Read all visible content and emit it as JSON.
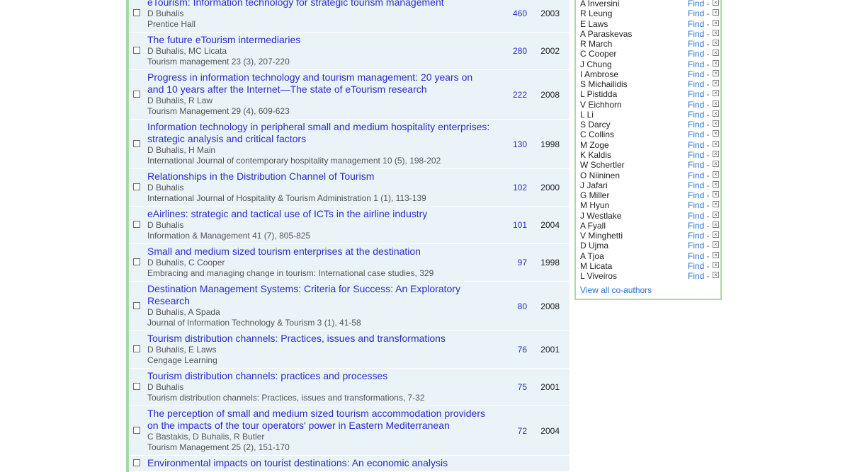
{
  "publications": [
    {
      "title": "eTourism: Information technology for strategic tourism management",
      "authors": "D Buhalis",
      "venue": "Prentice Hall",
      "cites": "460",
      "year": "2003"
    },
    {
      "title": "The future eTourism intermediaries",
      "authors": "D Buhalis, MC Licata",
      "venue": "Tourism management 23 (3), 207-220",
      "cites": "280",
      "year": "2002"
    },
    {
      "title": "Progress in information technology and tourism management: 20 years on and 10 years after the Internet—The state of eTourism research",
      "authors": "D Buhalis, R Law",
      "venue": "Tourism Management 29 (4), 609-623",
      "cites": "222",
      "year": "2008"
    },
    {
      "title": "Information technology in peripheral small and medium hospitality enterprises: strategic analysis and critical factors",
      "authors": "D Buhalis, H Main",
      "venue": "International Journal of contemporary hospitality management 10 (5), 198-202",
      "cites": "130",
      "year": "1998"
    },
    {
      "title": "Relationships in the Distribution Channel of Tourism",
      "authors": "D Buhalis",
      "venue": "International Journal of Hospitality & Tourism Administration 1 (1), 113-139",
      "cites": "102",
      "year": "2000"
    },
    {
      "title": "eAirlines: strategic and tactical use of ICTs in the airline industry",
      "authors": "D Buhalis",
      "venue": "Information & Management 41 (7), 805-825",
      "cites": "101",
      "year": "2004"
    },
    {
      "title": "Small and medium sized tourism enterprises at the destination",
      "authors": "D Buhalis, C Cooper",
      "venue": "Embracing and managing change in tourism: International case studies, 329",
      "cites": "97",
      "year": "1998"
    },
    {
      "title": "Destination Management Systems: Criteria for Success: An Exploratory Research",
      "authors": "D Buhalis, A Spada",
      "venue": "Journal of Information Technology & Tourism 3 (1), 41-58",
      "cites": "80",
      "year": "2008"
    },
    {
      "title": "Tourism distribution channels: Practices, issues and transformations",
      "authors": "D Buhalis, E Laws",
      "venue": "Cengage Learning",
      "cites": "76",
      "year": "2001"
    },
    {
      "title": "Tourism distribution channels: practices and processes",
      "authors": "D Buhalis",
      "venue": "Tourism distribution channels: Practices, issues and transformations, 7-32",
      "cites": "75",
      "year": "2001"
    },
    {
      "title": "The perception of small and medium sized tourism accommodation providers on the impacts of the tour operators' power in Eastern Mediterranean",
      "authors": "C Bastakis, D Buhalis, R Butler",
      "venue": "Tourism Management 25 (2), 151-170",
      "cites": "72",
      "year": "2004"
    },
    {
      "title": "Environmental impacts on tourist destinations: An economic analysis",
      "authors": "",
      "venue": "",
      "cites": "",
      "year": ""
    }
  ],
  "coauthors": {
    "find_label": "Find -",
    "remove_glyph": "×",
    "names": [
      "A Inversini",
      "R Leung",
      "E Laws",
      "A Paraskevas",
      "R March",
      "C Cooper",
      "J Chung",
      "I Ambrose",
      "S Michailidis",
      "L Pistidda",
      "V Eichhorn",
      "L Li",
      "S Darcy",
      "C Collins",
      "M Zoge",
      "K Kaldis",
      "W Schertler",
      "O Niininen",
      "J Jafari",
      "G Miller",
      "M Hyun",
      "J Westlake",
      "A Fyall",
      "V Minghetti",
      "D Ujma",
      "A Tjoa",
      "M Licata",
      "L Viveiros"
    ],
    "view_all": "View all co-authors"
  }
}
